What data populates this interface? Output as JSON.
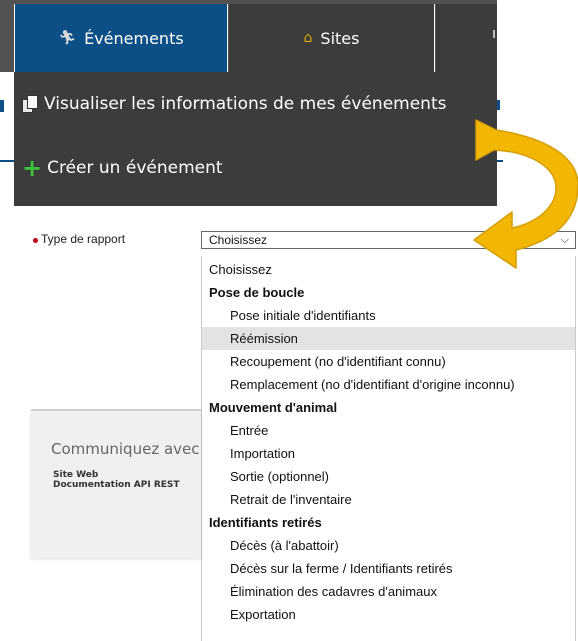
{
  "tabs": [
    {
      "label": "Événements",
      "icon": "running-person-icon",
      "active": true
    },
    {
      "label": "Sites",
      "icon": "house-icon",
      "active": false
    }
  ],
  "submenu": [
    {
      "label": "Visualiser les informations de mes événements",
      "icon": "documents-icon"
    },
    {
      "label": "Créer un événement",
      "icon": "plus-icon"
    }
  ],
  "form": {
    "type_label": "Type de rapport",
    "type_value": "Choisissez"
  },
  "options": [
    {
      "label": "Choisissez",
      "kind": "plain"
    },
    {
      "label": "Pose de boucle",
      "kind": "group"
    },
    {
      "label": "Pose initiale d'identifiants",
      "kind": "child"
    },
    {
      "label": "Réémission",
      "kind": "child",
      "highlighted": true
    },
    {
      "label": "Recoupement (no d'identifiant connu)",
      "kind": "child"
    },
    {
      "label": "Remplacement (no d'identifiant d'origine inconnu)",
      "kind": "child"
    },
    {
      "label": "Mouvement d'animal",
      "kind": "group"
    },
    {
      "label": "Entrée",
      "kind": "child"
    },
    {
      "label": "Importation",
      "kind": "child"
    },
    {
      "label": "Sortie (optionnel)",
      "kind": "child"
    },
    {
      "label": "Retrait de l'inventaire",
      "kind": "child"
    },
    {
      "label": "Identifiants retirés",
      "kind": "group"
    },
    {
      "label": "Décès (à l'abattoir)",
      "kind": "child"
    },
    {
      "label": "Décès sur la ferme / Identifiants retirés",
      "kind": "child"
    },
    {
      "label": "Élimination des cadavres d'animaux",
      "kind": "child"
    },
    {
      "label": "Exportation",
      "kind": "child"
    }
  ],
  "footer": {
    "title": "Communiquez avec",
    "links": [
      "Site Web",
      "Documentation API REST"
    ]
  },
  "colors": {
    "tab_active": "#0b4f86",
    "tab_dark": "#3c3c3c",
    "arrow": "#f2b705",
    "required": "#c0001a",
    "highlight": "#e3e3e3"
  }
}
